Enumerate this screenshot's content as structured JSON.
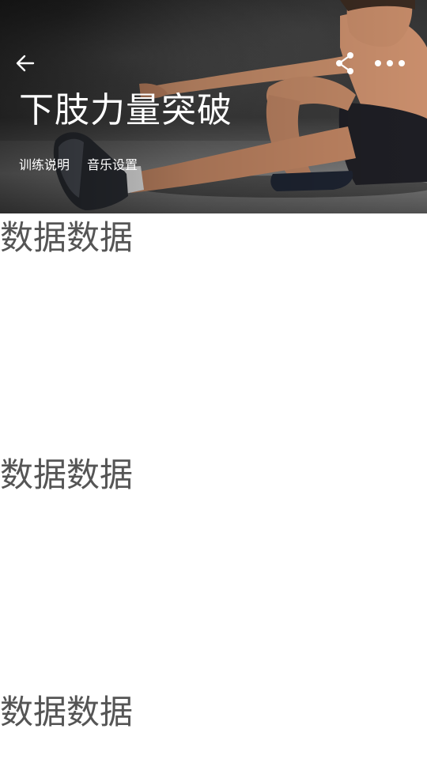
{
  "header": {
    "title": "下肢力量突破",
    "back_icon": "arrow-left-icon",
    "share_icon": "share-icon",
    "more_icon": "more-dots-icon",
    "tabs": [
      {
        "label": "训练说明"
      },
      {
        "label": "音乐设置"
      }
    ]
  },
  "content": {
    "sections": [
      {
        "label": "数据数据"
      },
      {
        "label": "数据数据"
      },
      {
        "label": "数据数据"
      }
    ]
  },
  "colors": {
    "hero_text": "#ffffff",
    "body_text": "#555555",
    "background": "#ffffff"
  }
}
